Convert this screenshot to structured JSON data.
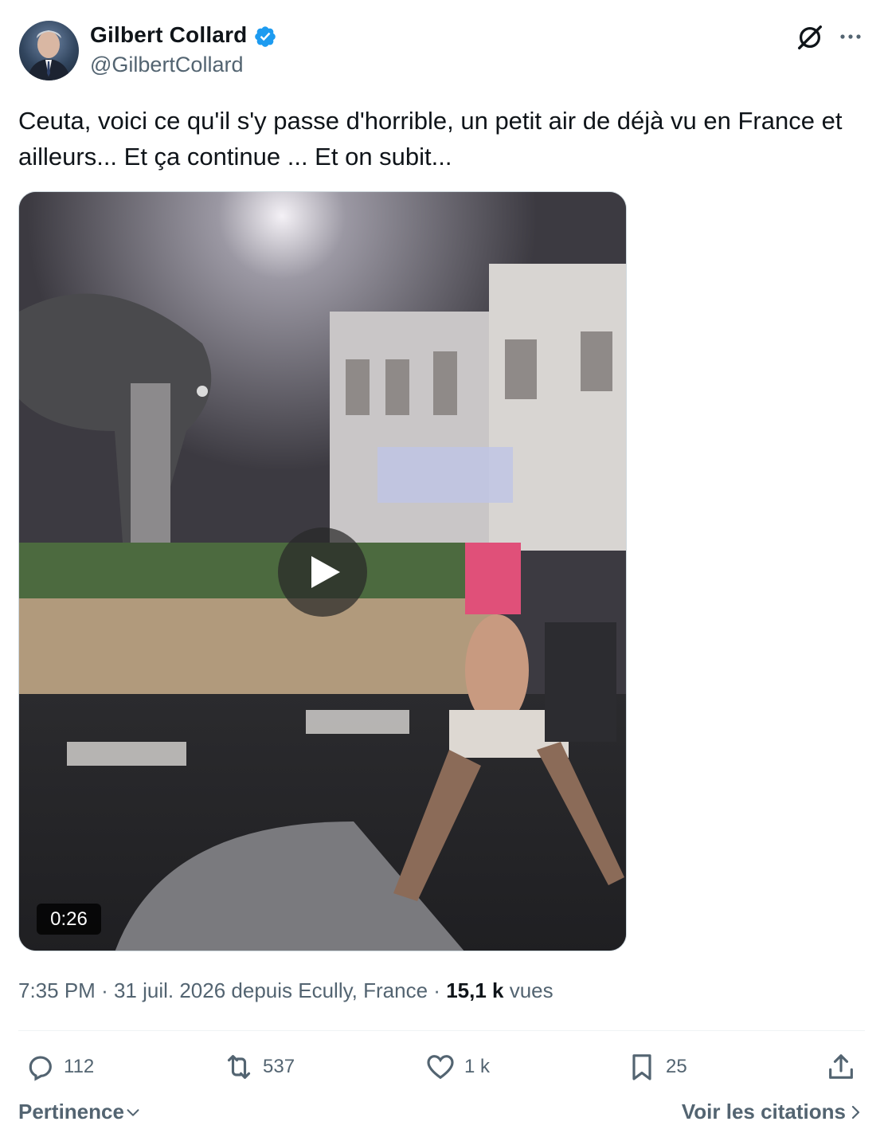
{
  "author": {
    "display_name": "Gilbert Collard",
    "handle": "@GilbertCollard",
    "verified": true,
    "avatar_icon": "avatar-portrait"
  },
  "tweet": {
    "text": "Ceuta, voici ce qu'il s'y passe d'horrible, un petit air de déjà vu en France et ailleurs... Et ça continue ... Et on subit..."
  },
  "media": {
    "type": "video",
    "duration": "0:26",
    "play_icon": "play-icon"
  },
  "meta": {
    "time": "7:35 PM",
    "separator": "·",
    "date_location": "31 juil. 2026 depuis Ecully, France",
    "views_count": "15,1 k",
    "views_label": "vues"
  },
  "actions": {
    "replies": "112",
    "reposts": "537",
    "likes": "1 k",
    "bookmarks": "25"
  },
  "footer": {
    "sort_label": "Pertinence",
    "quotes_label": "Voir les citations"
  },
  "colors": {
    "verified": "#1d9bf0",
    "text_primary": "#0f1419",
    "text_secondary": "#536471"
  }
}
